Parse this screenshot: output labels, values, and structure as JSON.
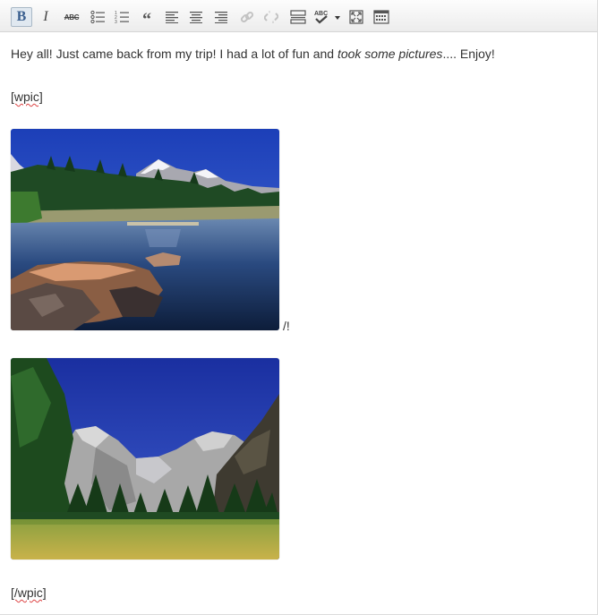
{
  "toolbar": {
    "buttons": [
      {
        "name": "bold-button",
        "icon": "bold-icon",
        "glyph": "B",
        "active": true
      },
      {
        "name": "italic-button",
        "icon": "italic-icon",
        "glyph": "I"
      },
      {
        "name": "strikethrough-button",
        "icon": "strikethrough-icon",
        "glyph": "ABC"
      },
      {
        "name": "bullet-list-button",
        "icon": "bullet-list-icon"
      },
      {
        "name": "numbered-list-button",
        "icon": "numbered-list-icon"
      },
      {
        "name": "blockquote-button",
        "icon": "blockquote-icon",
        "glyph": "“"
      },
      {
        "name": "align-left-button",
        "icon": "align-left-icon"
      },
      {
        "name": "align-center-button",
        "icon": "align-center-icon"
      },
      {
        "name": "align-right-button",
        "icon": "align-right-icon"
      },
      {
        "name": "insert-link-button",
        "icon": "link-icon",
        "disabled": true
      },
      {
        "name": "remove-link-button",
        "icon": "unlink-icon",
        "disabled": true
      },
      {
        "name": "insert-more-button",
        "icon": "more-tag-icon"
      },
      {
        "name": "spellcheck-button",
        "icon": "spellcheck-icon",
        "glyph": "ABC"
      },
      {
        "name": "fullscreen-button",
        "icon": "fullscreen-icon"
      },
      {
        "name": "kitchen-sink-button",
        "icon": "kitchen-sink-icon"
      }
    ]
  },
  "content": {
    "intro_plain": "Hey all! Just came back from my trip! I had a lot of fun and ",
    "intro_italic": "took some pictures",
    "intro_tail": ".... Enjoy!",
    "shortcode_open": "[wpic]",
    "after_photo1": "/!",
    "shortcode_close": "[/wpic]",
    "photos": [
      {
        "name": "lake-photo",
        "alt": "mountain lake with rocks"
      },
      {
        "name": "valley-photo",
        "alt": "mountain valley with meadow"
      }
    ]
  },
  "colors": {
    "text": "#333333",
    "toolbar_icon": "#555555",
    "active_bold": "#3a5f8f",
    "spell_underline": "#dd4444"
  }
}
